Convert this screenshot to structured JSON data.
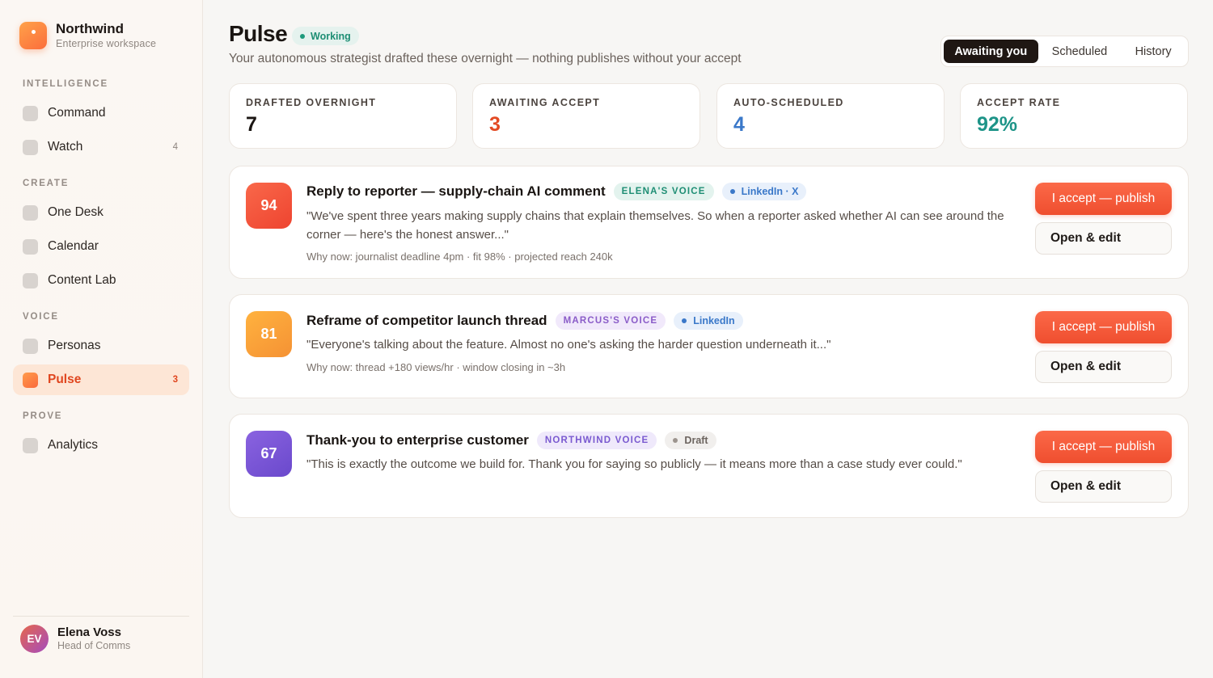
{
  "brand": {
    "name": "Northwind",
    "subtitle": "Enterprise workspace"
  },
  "sidebar": {
    "sections": [
      {
        "label": "INTELLIGENCE"
      },
      {
        "label": "CREATE"
      },
      {
        "label": "VOICE"
      },
      {
        "label": "PROVE"
      }
    ],
    "items": [
      {
        "label": "Command",
        "count": ""
      },
      {
        "label": "Watch",
        "count": "4"
      },
      {
        "label": "One Desk",
        "count": ""
      },
      {
        "label": "Calendar",
        "count": ""
      },
      {
        "label": "Content Lab",
        "count": ""
      },
      {
        "label": "Personas",
        "count": ""
      },
      {
        "label": "Pulse",
        "count": "3"
      },
      {
        "label": "Analytics",
        "count": ""
      }
    ],
    "active_item": "Pulse"
  },
  "user": {
    "initials": "EV",
    "name": "Elena Voss",
    "role": "Head of Comms"
  },
  "header": {
    "title": "Pulse",
    "status": "Working",
    "subtitle": "Your autonomous strategist drafted these overnight — nothing publishes without your accept",
    "tabs": [
      {
        "label": "Awaiting you",
        "active": true
      },
      {
        "label": "Scheduled",
        "active": false
      },
      {
        "label": "History",
        "active": false
      }
    ]
  },
  "stats": [
    {
      "label": "DRAFTED OVERNIGHT",
      "value": "7",
      "color": "#1a1512"
    },
    {
      "label": "AWAITING ACCEPT",
      "value": "3",
      "color": "#e34a24"
    },
    {
      "label": "AUTO-SCHEDULED",
      "value": "4",
      "color": "#3a78c9"
    },
    {
      "label": "ACCEPT RATE",
      "value": "92%",
      "color": "#1e9488"
    }
  ],
  "cards": [
    {
      "score": "94",
      "title": "Reply to reporter — supply-chain AI comment",
      "voice": "ELENA'S VOICE",
      "channel": "LinkedIn · X",
      "quote": "\"We've spent three years making supply chains that explain themselves. So when a reporter asked whether AI can see around the corner — here's the honest answer...\"",
      "why": "Why now: journalist deadline 4pm · fit 98% · projected reach 240k",
      "accept_label": "I accept — publish",
      "edit_label": "Open & edit"
    },
    {
      "score": "81",
      "title": "Reframe of competitor launch thread",
      "voice": "MARCUS'S VOICE",
      "channel": "LinkedIn",
      "quote": "\"Everyone's talking about the feature. Almost no one's asking the harder question underneath it...\"",
      "why": "Why now: thread +180 views/hr · window closing in ~3h",
      "accept_label": "I accept — publish",
      "edit_label": "Open & edit"
    },
    {
      "score": "67",
      "title": "Thank-you to enterprise customer",
      "voice": "NORTHWIND VOICE",
      "channel": "Draft",
      "quote": "\"This is exactly the outcome we build for. Thank you for saying so publicly — it means more than a case study ever could.\"",
      "why": "",
      "accept_label": "I accept — publish",
      "edit_label": "Open & edit"
    }
  ],
  "colors": {
    "accent": "#ef4e2f",
    "score_high": "#f2543a",
    "score_mid": "#f7a23a",
    "score_low": "#7a57d6",
    "voice_elena": "#1e8e74",
    "voice_marcus": "#8a5cc8",
    "voice_northwind": "#7a5ad0",
    "channel_linkedin": "#3a78c9",
    "channel_draft": "#6d6560"
  },
  "icons": {
    "brand": "app-logo-icon",
    "nav": "nav-square-icon",
    "status": "status-dot-icon"
  }
}
